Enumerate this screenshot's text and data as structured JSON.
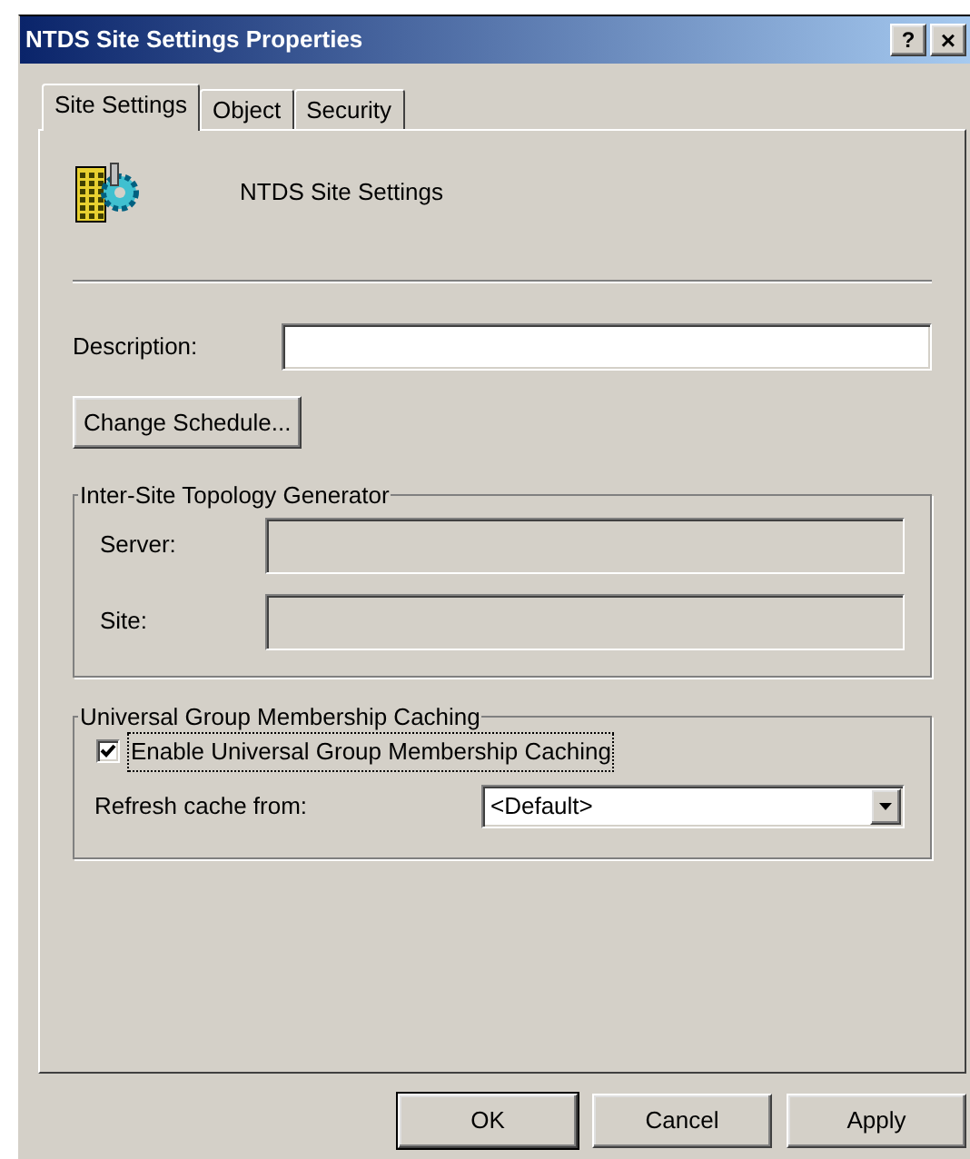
{
  "window": {
    "title": "NTDS Site Settings Properties",
    "help_button": "?",
    "close_button": "×"
  },
  "tabs": [
    {
      "label": "Site Settings",
      "selected": true
    },
    {
      "label": "Object",
      "selected": false
    },
    {
      "label": "Security",
      "selected": false
    }
  ],
  "header": {
    "name": "NTDS Site Settings"
  },
  "description": {
    "label": "Description:"
  },
  "change_schedule": {
    "label": "Change Schedule..."
  },
  "topology_group": {
    "title": "Inter-Site Topology Generator",
    "fields": [
      {
        "label": "Server:",
        "disabled": true
      },
      {
        "label": "Site:",
        "disabled": true
      }
    ]
  },
  "caching_group": {
    "title": "Universal Group Membership Caching",
    "checkbox": {
      "label": "Enable Universal Group Membership Caching",
      "checked": true,
      "focused": true
    },
    "refresh": {
      "label": "Refresh cache from:",
      "value": "<Default>"
    }
  },
  "buttons": [
    {
      "label": "OK",
      "default": true
    },
    {
      "label": "Cancel",
      "default": false
    },
    {
      "label": "Apply",
      "default": false
    }
  ]
}
